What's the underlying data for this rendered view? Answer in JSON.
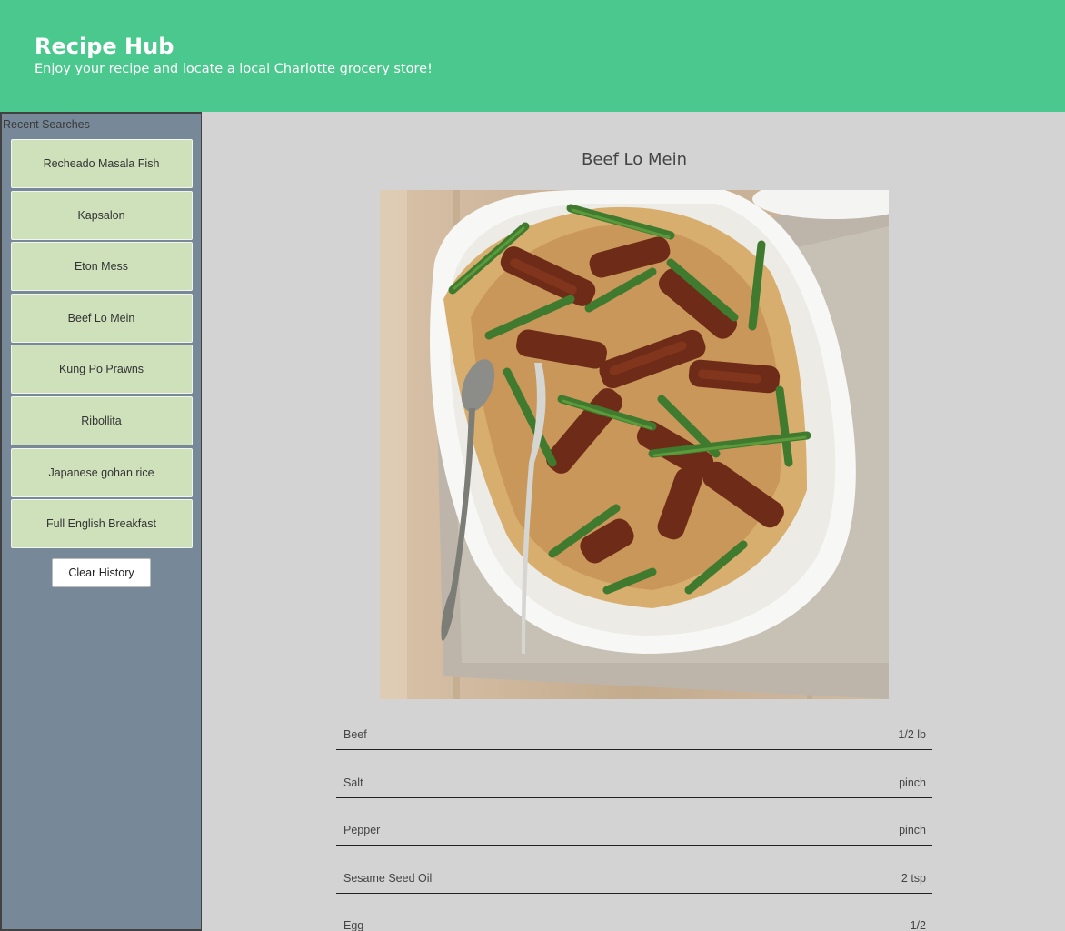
{
  "header": {
    "title": "Recipe Hub",
    "subtitle": "Enjoy your recipe and locate a local Charlotte grocery store!"
  },
  "sidebar": {
    "title": "Recent Searches",
    "items": [
      {
        "label": "Recheado Masala Fish"
      },
      {
        "label": "Kapsalon"
      },
      {
        "label": "Eton Mess"
      },
      {
        "label": "Beef Lo Mein"
      },
      {
        "label": "Kung Po Prawns"
      },
      {
        "label": "Ribollita"
      },
      {
        "label": "Japanese gohan rice"
      },
      {
        "label": "Full English Breakfast"
      }
    ],
    "clear_label": "Clear History"
  },
  "recipe": {
    "title": "Beef Lo Mein",
    "ingredients": [
      {
        "name": "Beef",
        "amount": "1/2 lb"
      },
      {
        "name": "Salt",
        "amount": "pinch"
      },
      {
        "name": "Pepper",
        "amount": "pinch"
      },
      {
        "name": "Sesame Seed Oil",
        "amount": "2 tsp"
      },
      {
        "name": "Egg",
        "amount": "1/2"
      }
    ]
  },
  "colors": {
    "header_bg": "#4bc88d",
    "sidebar_bg": "#778899",
    "item_bg": "#cfe1bb",
    "page_bg": "#d3d3d3"
  }
}
